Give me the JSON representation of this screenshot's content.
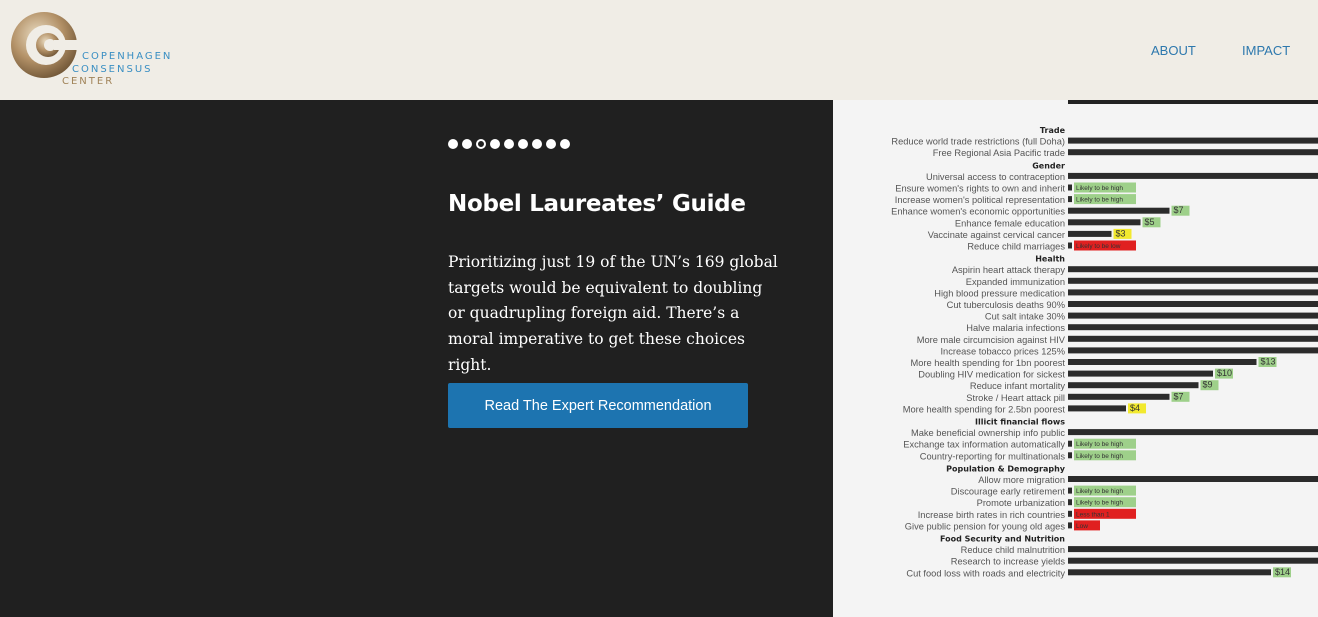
{
  "brand": {
    "line1": "COPENHAGEN",
    "line2": "CONSENSUS",
    "line3": "CENTER"
  },
  "nav": {
    "about": "ABOUT",
    "impact": "IMPACT"
  },
  "hero": {
    "slide_count": 9,
    "active_slide": 3,
    "title": "Nobel Laureates’ Guide",
    "body": "Prioritizing just 19 of the UN’s 169 global targets would be equivalent to doubling or quadrupling foreign aid. There’s a moral imperative to get these choices right.",
    "cta": "Read The Expert Recommendation"
  },
  "colors": {
    "accent": "#1d74b0",
    "bar": "#2b2b2b",
    "green": "#9ed08a",
    "yellow": "#f2e92e",
    "red": "#e02020"
  },
  "chart_data": {
    "type": "bar",
    "sections": [
      {
        "heading": "Trade",
        "rows": [
          {
            "label": "Reduce world trade restrictions (full Doha)",
            "tag": ""
          },
          {
            "label": "Free Regional Asia Pacific trade",
            "tag": ""
          }
        ]
      },
      {
        "heading": "Gender",
        "rows": [
          {
            "label": "Universal access to contraception",
            "tag": ""
          },
          {
            "label": "Ensure women's rights to own and inherit",
            "tag": "Likely to be high",
            "tagcolor": "green"
          },
          {
            "label": "Increase women's political representation",
            "tag": "Likely to be high",
            "tagcolor": "green"
          },
          {
            "label": "Enhance women's economic opportunities",
            "tag": "$7",
            "tagcolor": "green"
          },
          {
            "label": "Enhance female education",
            "tag": "$5",
            "tagcolor": "green"
          },
          {
            "label": "Vaccinate against cervical cancer",
            "tag": "$3",
            "tagcolor": "yellow"
          },
          {
            "label": "Reduce child marriages",
            "tag": "Likely to be low",
            "tagcolor": "red"
          }
        ]
      },
      {
        "heading": "Health",
        "rows": [
          {
            "label": "Aspirin heart attack therapy",
            "tag": ""
          },
          {
            "label": "Expanded immunization",
            "tag": ""
          },
          {
            "label": "High blood pressure medication",
            "tag": ""
          },
          {
            "label": "Cut tuberculosis deaths 90%",
            "tag": ""
          },
          {
            "label": "Cut salt intake 30%",
            "tag": ""
          },
          {
            "label": "Halve malaria infections",
            "tag": ""
          },
          {
            "label": "More male circumcision against HIV",
            "tag": ""
          },
          {
            "label": "Increase tobacco prices 125%",
            "tag": ""
          },
          {
            "label": "More health spending for 1bn poorest",
            "tag": "$13",
            "tagcolor": "green"
          },
          {
            "label": "Doubling HIV medication for sickest",
            "tag": "$10",
            "tagcolor": "green"
          },
          {
            "label": "Reduce infant mortality",
            "tag": "$9",
            "tagcolor": "green"
          },
          {
            "label": "Stroke / Heart attack pill",
            "tag": "$7",
            "tagcolor": "green"
          },
          {
            "label": "More health spending for 2.5bn poorest",
            "tag": "$4",
            "tagcolor": "yellow"
          }
        ]
      },
      {
        "heading": "Illicit financial flows",
        "rows": [
          {
            "label": "Make beneficial ownership info public",
            "tag": ""
          },
          {
            "label": "Exchange tax information automatically",
            "tag": "Likely to be high",
            "tagcolor": "green"
          },
          {
            "label": "Country-reporting for multinationals",
            "tag": "Likely to be high",
            "tagcolor": "green"
          }
        ]
      },
      {
        "heading": "Population & Demography",
        "rows": [
          {
            "label": "Allow more migration",
            "tag": ""
          },
          {
            "label": "Discourage early retirement",
            "tag": "Likely to be high",
            "tagcolor": "green"
          },
          {
            "label": "Promote urbanization",
            "tag": "Likely to be high",
            "tagcolor": "green"
          },
          {
            "label": "Increase birth rates in rich countries",
            "tag": "Less than 1",
            "tagcolor": "red"
          },
          {
            "label": "Give public pension for young old ages",
            "tag": "Low",
            "tagcolor": "red"
          }
        ]
      },
      {
        "heading": "Food Security and Nutrition",
        "rows": [
          {
            "label": "Reduce child malnutrition",
            "tag": ""
          },
          {
            "label": "Research to increase yields",
            "tag": ""
          },
          {
            "label": "Cut food loss with roads and electricity",
            "tag": "$14",
            "tagcolor": "green"
          }
        ]
      }
    ]
  }
}
